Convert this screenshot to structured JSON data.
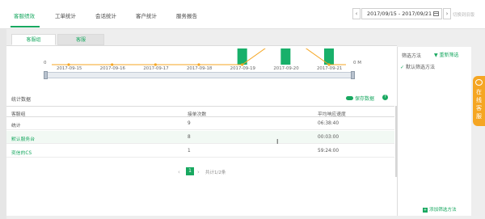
{
  "topnav": {
    "tabs": [
      "客服绩效",
      "工单统计",
      "会话统计",
      "客户统计",
      "服务报告"
    ],
    "date_range": "2017/09/15 - 2017/09/21",
    "prev_label": "‹",
    "next_label": "›",
    "switch_label": "切换到旧版"
  },
  "subtabs": [
    "客服组",
    "客服"
  ],
  "chart_data": {
    "type": "bar",
    "x": [
      "2017-09-15",
      "2017-09-16",
      "2017-09-17",
      "2017-09-18",
      "2017-09-19",
      "2017-09-20",
      "2017-09-21"
    ],
    "y_left_label": "0",
    "y_right_label": "0 M",
    "series": [
      {
        "type": "line",
        "values": [
          0,
          0,
          0,
          0,
          0,
          1,
          0
        ]
      },
      {
        "type": "bar",
        "values": [
          0,
          0,
          0,
          0,
          1,
          1,
          1
        ]
      }
    ],
    "colors": {
      "line": "#f5a623",
      "bar": "#18b06a"
    }
  },
  "section": {
    "title": "统计数据",
    "save_label": "保存数据",
    "help": "?"
  },
  "table": {
    "headers": [
      "客服组",
      "接单次数",
      "平均响应速度"
    ],
    "rows": [
      {
        "name": "统计",
        "count": "9",
        "speed": "06:38:40",
        "link": false
      },
      {
        "name": "默认服务台",
        "count": "8",
        "speed": "00:03:00",
        "link": true
      },
      {
        "name": "奕信的CS",
        "count": "1",
        "speed": "59:24:00",
        "link": true
      }
    ]
  },
  "pager": {
    "prev": "‹",
    "current": "1",
    "next": "›",
    "total": "共计1/2条"
  },
  "filter_panel": {
    "title": "筛选方法",
    "reset": "重新筛选",
    "default_item": "默认筛选方法",
    "add": "添加筛选方法"
  },
  "side_tab": "在线客服",
  "colors": {
    "accent": "#18a860",
    "orange": "#f5a623"
  }
}
